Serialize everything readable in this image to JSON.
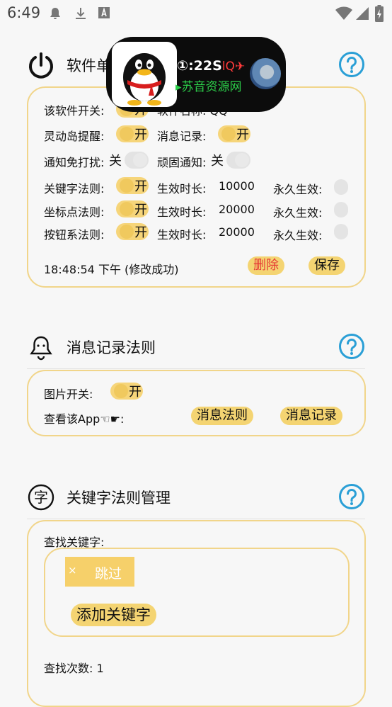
{
  "status_bar": {
    "time": "6:49"
  },
  "island": {
    "line1_text": "①:22S",
    "line1_qq": "lQ✈",
    "line2": "▸苏音资源网"
  },
  "section1": {
    "title": "软件单",
    "rows": {
      "software_switch": "该软件开关:",
      "software_switch_state": "开",
      "software_name": "软件名称: QQ",
      "island_remind": "灵动岛提醒:",
      "island_remind_state": "开",
      "msg_record": "消息记录:",
      "msg_record_state": "开",
      "dnd": "通知免打扰:",
      "dnd_state": "关",
      "sticky": "顽固通知:",
      "sticky_state": "关",
      "keyword_rule": "关键字法则:",
      "keyword_rule_state": "开",
      "coord_rule": "坐标点法则:",
      "coord_rule_state": "开",
      "button_rule": "按钮系法则:",
      "button_rule_state": "开",
      "duration_label": "生效时长:",
      "duration1": "10000",
      "duration2": "20000",
      "duration3": "20000",
      "permanent_label": "永久生效:"
    },
    "timestamp": "18:48:54 下午 (修改成功)",
    "delete_btn": "删除",
    "save_btn": "保存"
  },
  "section2": {
    "title": "消息记录法则",
    "image_switch": "图片开关:",
    "image_switch_state": "开",
    "view_app": "查看该App☜☛:",
    "msg_rule_btn": "消息法则",
    "msg_record_btn": "消息记录"
  },
  "section3": {
    "title": "关键字法则管理",
    "search_label": "查找关键字:",
    "tag_close": "×",
    "tag_label": "跳过",
    "add_btn": "添加关键字",
    "count": "查找次数: 1"
  },
  "colors": {
    "accent": "#f4d472",
    "border": "#f1d58a",
    "help": "#2a9fd6",
    "danger": "#e53935"
  }
}
